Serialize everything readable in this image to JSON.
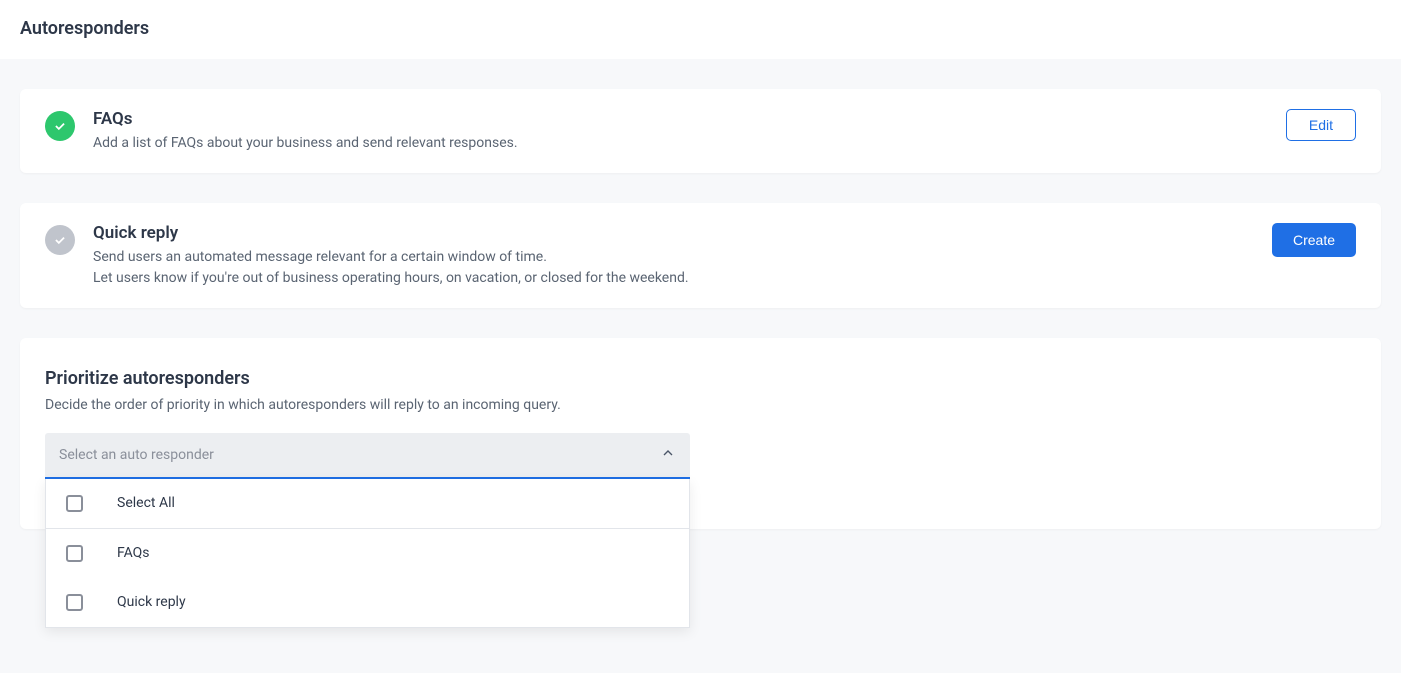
{
  "header": {
    "title": "Autoresponders"
  },
  "cards": {
    "faqs": {
      "title": "FAQs",
      "desc": "Add a list of FAQs about your business and send relevant responses.",
      "action": "Edit"
    },
    "quick_reply": {
      "title": "Quick reply",
      "desc_line1": "Send users an automated message relevant for a certain window of time.",
      "desc_line2": "Let users know if you're out of business operating hours, on vacation, or closed for the weekend.",
      "action": "Create"
    }
  },
  "prioritize": {
    "title": "Prioritize autoresponders",
    "desc": "Decide the order of priority in which autoresponders will reply to an incoming query.",
    "select_placeholder": "Select an auto responder",
    "options": {
      "select_all": "Select All",
      "faqs": "FAQs",
      "quick_reply": "Quick reply"
    }
  }
}
